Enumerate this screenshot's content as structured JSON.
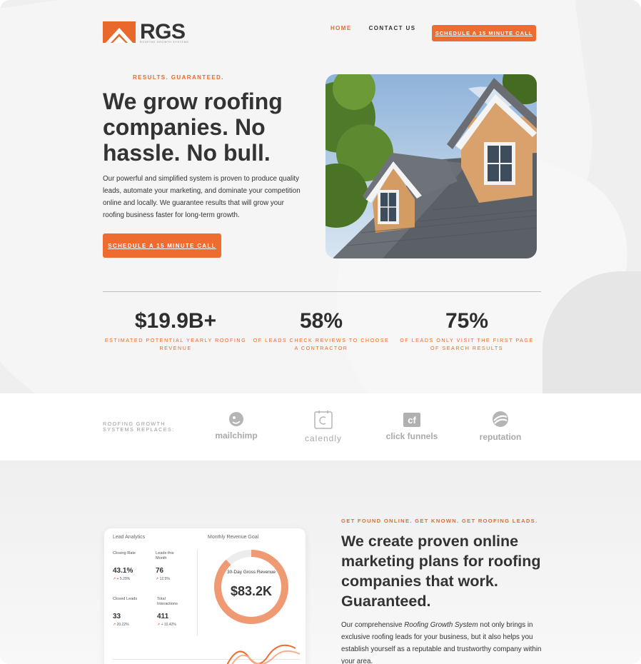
{
  "brand": {
    "name": "RGS",
    "tagline": "ROOFING GROWTH SYSTEMS",
    "accent": "#ee6c2f"
  },
  "nav": {
    "items": [
      {
        "label": "HOME",
        "active": true
      },
      {
        "label": "CONTACT US",
        "active": false
      }
    ],
    "cta": "SCHEDULE A 15 MINUTE CALL"
  },
  "hero": {
    "eyebrow": "RESULTS. GUARANTEED.",
    "title": "We grow roofing companies. No hassle. No bull.",
    "body": "Our powerful and simplified system is proven to produce quality leads, automate your marketing, and dominate your competition online and locally. We guarantee results that will grow your roofing business faster for long-term growth.",
    "cta": "SCHEDULE A 15 MINUTE CALL"
  },
  "stats": [
    {
      "value": "$19.9B+",
      "label": "ESTIMATED POTENTIAL YEARLY ROOFING REVENUE"
    },
    {
      "value": "58%",
      "label": "OF LEADS CHECK REVIEWS TO CHOOSE A CONTRACTOR"
    },
    {
      "value": "75%",
      "label": "OF LEADS ONLY VISIT THE FIRST PAGE OF SEARCH RESULTS"
    }
  ],
  "replaces": {
    "label": "ROOFING GROWTH SYSTEMS REPLACES:",
    "partners": [
      {
        "name": "mailchimp",
        "icon": "mailchimp-icon"
      },
      {
        "name": "calendly",
        "icon": "calendly-icon"
      },
      {
        "name": "click funnels",
        "icon": "clickfunnels-icon"
      },
      {
        "name": "reputation",
        "icon": "reputation-icon"
      }
    ]
  },
  "dashboard": {
    "analytics_title": "Lead Analytics",
    "revenue_title": "Monthly Revenue Goal",
    "metrics": [
      {
        "label": "Closing Rate",
        "value": "43.1%",
        "change": "+ 5.29%"
      },
      {
        "label": "Leads this Month",
        "value": "76",
        "change": "12.5%"
      },
      {
        "label": "Closed Leads",
        "value": "33",
        "change": "20.22%"
      },
      {
        "label": "Total Interactions",
        "value": "411",
        "change": "+ 10.42%"
      }
    ],
    "donut_label": "30-Day Gross Revenue",
    "donut_value": "$83.2K",
    "donut_progress": 0.88
  },
  "section": {
    "eyebrow": "GET FOUND ONLINE. GET KNOWN. GET ROOFING LEADS.",
    "title": "We create proven online marketing plans for roofing companies that work. Guaranteed.",
    "body_pre": "Our comprehensive ",
    "body_em": "Roofing Growth System",
    "body_post": " not only brings in exclusive roofing leads for your business, but it also helps you establish yourself as a reputable and trustworthy company within your area."
  }
}
